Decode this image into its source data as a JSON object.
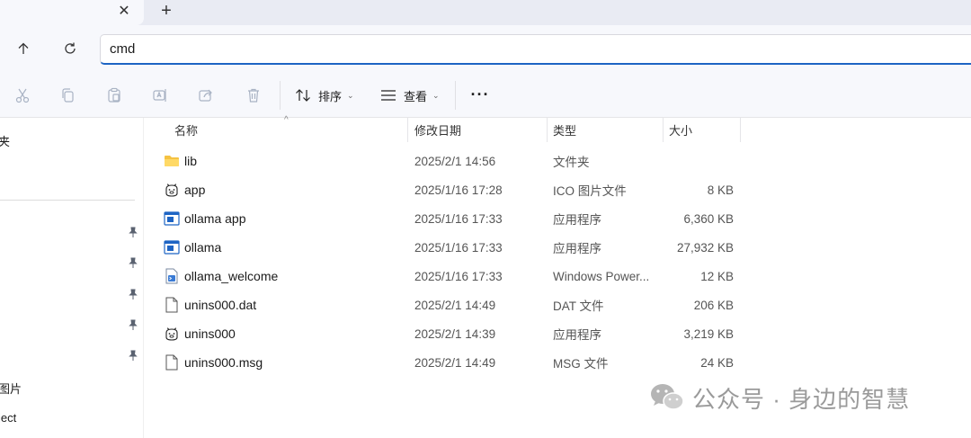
{
  "tabstrip": {
    "close_glyph": "✕",
    "new_tab_glyph": "+"
  },
  "addressbar": {
    "value": "cmd"
  },
  "commandbar": {
    "sort_label": "排序",
    "view_label": "查看",
    "more_glyph": "···"
  },
  "navpane": {
    "items": [
      {
        "label": "夹"
      },
      {
        "label": "图片"
      },
      {
        "label": "ject"
      }
    ]
  },
  "columns": {
    "name": "名称",
    "modified": "修改日期",
    "type": "类型",
    "size": "大小"
  },
  "files": [
    {
      "icon": "folder-icon",
      "name": "lib",
      "modified": "2025/2/1 14:56",
      "type": "文件夹",
      "size": ""
    },
    {
      "icon": "app-ico-icon",
      "name": "app",
      "modified": "2025/1/16 17:28",
      "type": "ICO 图片文件",
      "size": "8 KB"
    },
    {
      "icon": "exe-icon",
      "name": "ollama app",
      "modified": "2025/1/16 17:33",
      "type": "应用程序",
      "size": "6,360 KB"
    },
    {
      "icon": "exe-icon",
      "name": "ollama",
      "modified": "2025/1/16 17:33",
      "type": "应用程序",
      "size": "27,932 KB"
    },
    {
      "icon": "powershell-script-icon",
      "name": "ollama_welcome",
      "modified": "2025/1/16 17:33",
      "type": "Windows Power...",
      "size": "12 KB"
    },
    {
      "icon": "document-icon",
      "name": "unins000.dat",
      "modified": "2025/2/1 14:49",
      "type": "DAT 文件",
      "size": "206 KB"
    },
    {
      "icon": "app-ico-icon",
      "name": "unins000",
      "modified": "2025/2/1 14:39",
      "type": "应用程序",
      "size": "3,219 KB"
    },
    {
      "icon": "document-icon",
      "name": "unins000.msg",
      "modified": "2025/2/1 14:49",
      "type": "MSG 文件",
      "size": "24 KB"
    }
  ],
  "watermark": {
    "text": "公众号 · 身边的智慧"
  },
  "colors": {
    "accent": "#1d64c4",
    "folder": "#f5c242",
    "chrome_bg": "#f7f8fc",
    "tab_strip_bg": "#e9ebf3"
  }
}
